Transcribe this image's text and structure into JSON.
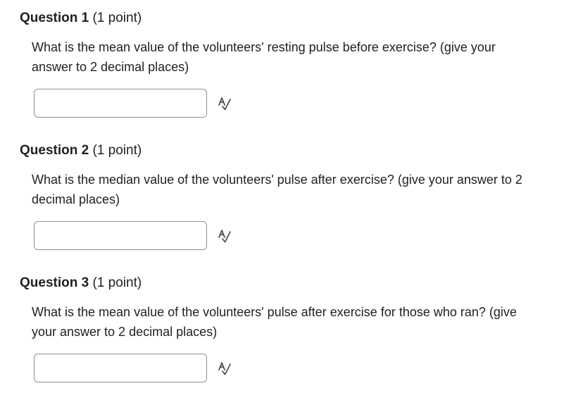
{
  "questions": [
    {
      "title": "Question 1",
      "points": "(1 point)",
      "text": "What is the mean value of the volunteers' resting pulse before exercise? (give your answer to 2 decimal places)",
      "answer_value": "",
      "icon": "spell-check-icon"
    },
    {
      "title": "Question 2",
      "points": "(1 point)",
      "text": "What is the median value of the volunteers' pulse after exercise? (give your answer to 2 decimal places)",
      "answer_value": "",
      "icon": "spell-check-icon"
    },
    {
      "title": "Question 3",
      "points": "(1 point)",
      "text": "What is the mean value of the volunteers' pulse after exercise for those who ran? (give your answer to 2 decimal places)",
      "answer_value": "",
      "icon": "spell-check-icon"
    }
  ]
}
